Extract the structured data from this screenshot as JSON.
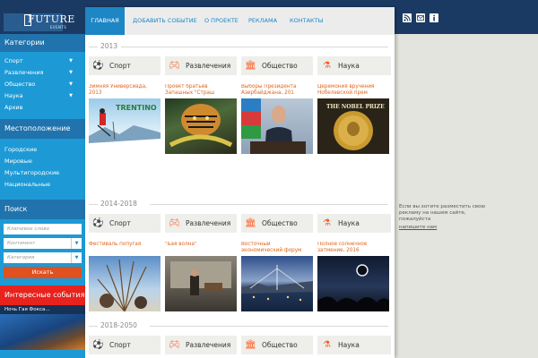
{
  "logo": {
    "text": "FUTURE",
    "sub": "EVENTS"
  },
  "sidebar": {
    "categories_title": "Категории",
    "categories": [
      {
        "label": "Спорт",
        "has_arrow": true
      },
      {
        "label": "Развлечения",
        "has_arrow": true
      },
      {
        "label": "Общество",
        "has_arrow": true
      },
      {
        "label": "Наука",
        "has_arrow": true
      },
      {
        "label": "Архив",
        "has_arrow": false
      }
    ],
    "location_title": "Местоположение",
    "locations": [
      "Городские",
      "Мировые",
      "Мультигородские",
      "Национальные"
    ],
    "search_title": "Поиск",
    "search": {
      "keyword_placeholder": "Ключевое слово",
      "continent_placeholder": "Континент",
      "category_placeholder": "Категория",
      "button": "Искать"
    },
    "interesting_title": "Интересные события",
    "interesting_event": "Ночь Гая Фокса..."
  },
  "nav": [
    "ГЛАВНАЯ",
    "ДОБАВИТЬ СОБЫТИЕ",
    "О ПРОЕКТЕ",
    "РЕКЛАМА",
    "КОНТАКТЫ"
  ],
  "header_icons": [
    "rss-icon",
    "mail-icon",
    "info-icon"
  ],
  "sections": [
    {
      "year": "2013",
      "categories": [
        "Спорт",
        "Развлечения",
        "Общество",
        "Наука"
      ],
      "events": [
        "Зимняя Универсиада, 2013",
        "Проект братьев Запашных \"Страш",
        "Выборы Президента Азербайджана, 201",
        "Церемония вручения Нобелевской прем"
      ]
    },
    {
      "year": "2014-2018",
      "categories": [
        "Спорт",
        "Развлечения",
        "Общество",
        "Наука"
      ],
      "events": [
        "Фестиваль попугая",
        "\"Бая волна\"",
        "Восточный экономический форум",
        "Полное солнечное затмение, 2016"
      ]
    },
    {
      "year": "2018-2050",
      "categories": [
        "Спорт",
        "Развлечения",
        "Общество",
        "Наука"
      ],
      "events": []
    }
  ],
  "ad": {
    "text": "Если вы хотите разместить свою рекламу на нашем сайте, пожалуйста",
    "link": "напишите нам"
  },
  "image_text": {
    "trentino": "TRENTINO",
    "nobel": "THE NOBEL PRIZE"
  },
  "colors": {
    "accent": "#1d86c4",
    "sidebar": "#1d9ad6",
    "dark": "#1b3a63",
    "orange": "#e0651c",
    "red": "#e8221d"
  }
}
